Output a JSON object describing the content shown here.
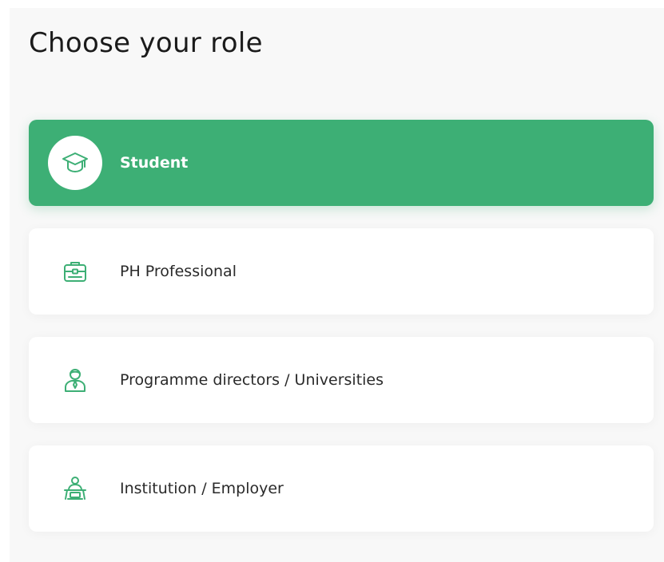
{
  "page": {
    "title": "Choose your role"
  },
  "theme": {
    "accent": "#3daf75",
    "icon_color": "#3daf75"
  },
  "roles": [
    {
      "label": "Student",
      "icon": "graduation-cap-icon",
      "selected": true
    },
    {
      "label": "PH Professional",
      "icon": "briefcase-icon",
      "selected": false
    },
    {
      "label": "Programme directors / Universities",
      "icon": "teacher-icon",
      "selected": false
    },
    {
      "label": "Institution / Employer",
      "icon": "employer-desk-icon",
      "selected": false
    }
  ]
}
